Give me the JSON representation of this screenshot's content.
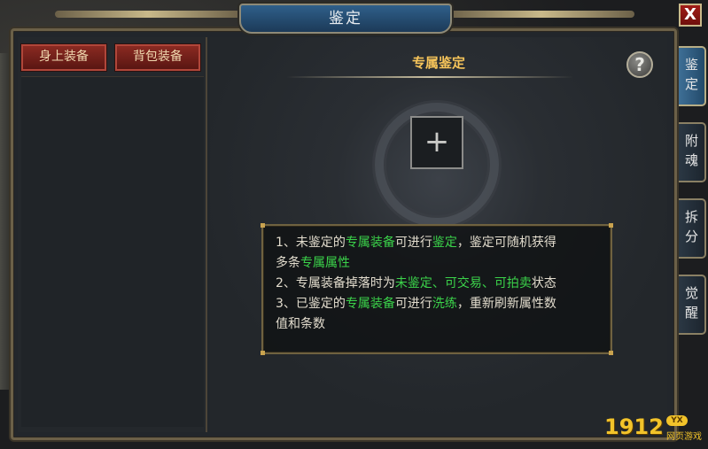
{
  "window": {
    "title": "鉴定",
    "close_label": "X"
  },
  "left_tabs": [
    {
      "label": "身上装备",
      "active": true
    },
    {
      "label": "背包装备",
      "active": false
    }
  ],
  "main": {
    "heading": "专属鉴定",
    "help_label": "?",
    "slot_label": "+",
    "info_lines": [
      [
        {
          "t": "1、未鉴定的",
          "hl": false
        },
        {
          "t": "专属装备",
          "hl": true
        },
        {
          "t": "可进行",
          "hl": false
        },
        {
          "t": "鉴定",
          "hl": true
        },
        {
          "t": "，鉴定可随机获得",
          "hl": false
        }
      ],
      [
        {
          "t": "多条",
          "hl": false
        },
        {
          "t": "专属属性",
          "hl": true
        }
      ],
      [
        {
          "t": "2、专属装备掉落时为",
          "hl": false
        },
        {
          "t": "未鉴定、可交易、可拍卖",
          "hl": true
        },
        {
          "t": "状态",
          "hl": false
        }
      ],
      [
        {
          "t": "3、已鉴定的",
          "hl": false
        },
        {
          "t": "专属装备",
          "hl": true
        },
        {
          "t": "可进行",
          "hl": false
        },
        {
          "t": "洗练",
          "hl": true
        },
        {
          "t": "，重新刷新属性数",
          "hl": false
        }
      ],
      [
        {
          "t": "值和条数",
          "hl": false
        }
      ]
    ]
  },
  "right_tabs": [
    {
      "label": "鉴定",
      "active": true
    },
    {
      "label": "附魂",
      "active": false
    },
    {
      "label": "拆分",
      "active": false
    },
    {
      "label": "觉醒",
      "active": false
    }
  ],
  "watermark": {
    "number": "1912",
    "badge": "YX",
    "sub": "网页游戏"
  },
  "colors": {
    "highlight": "#3bd34a",
    "heading": "#f6c45a",
    "tab_red": "#8a2a22",
    "active_blue": "#3e6f96"
  }
}
